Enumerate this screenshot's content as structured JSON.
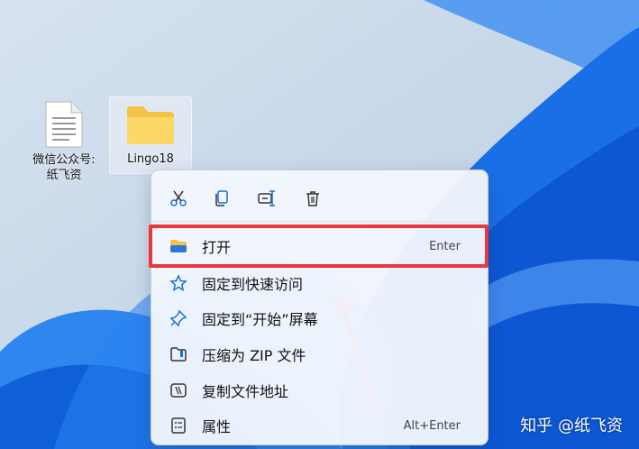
{
  "desktop": {
    "file_icon": {
      "line1": "微信公众号:",
      "line2": "纸飞资"
    },
    "folder_icon": {
      "label": "Lingo18"
    }
  },
  "context_menu": {
    "toolbar": [
      "cut-icon",
      "copy-icon",
      "rename-icon",
      "delete-icon"
    ],
    "items": [
      {
        "label": "打开",
        "shortcut": "Enter",
        "icon": "folder-icon"
      },
      {
        "label": "固定到快速访问",
        "shortcut": "",
        "icon": "star-icon"
      },
      {
        "label": "固定到“开始”屏幕",
        "shortcut": "",
        "icon": "pin-icon"
      },
      {
        "label": "压缩为 ZIP 文件",
        "shortcut": "",
        "icon": "zip-icon"
      },
      {
        "label": "复制文件地址",
        "shortcut": "",
        "icon": "path-icon"
      },
      {
        "label": "属性",
        "shortcut": "Alt+Enter",
        "icon": "properties-icon"
      }
    ]
  },
  "watermark": "知乎 @纸飞资",
  "colors": {
    "highlight": "#e8383e",
    "accent": "#1a6fd6"
  }
}
